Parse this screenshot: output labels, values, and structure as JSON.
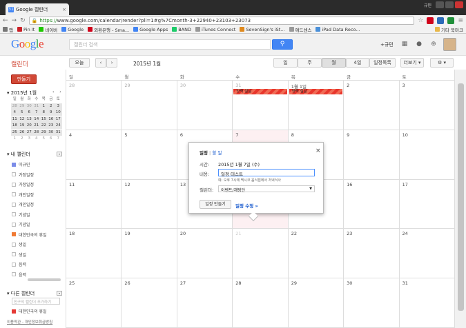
{
  "browser": {
    "tab_title": "Google 캘린더",
    "tab_close": "×",
    "user_badge": "규민",
    "url_https": "https://",
    "url_rest": "www.google.com/calendar/render?pli=1#g%7Cmonth-3+22940+23103+23073",
    "bookmarks": [
      {
        "label": "앱",
        "color": "#777777"
      },
      {
        "label": "Pin It",
        "color": "#cb2027"
      },
      {
        "label": "네이버",
        "color": "#1ec800"
      },
      {
        "label": "Google",
        "color": "#4285f4"
      },
      {
        "label": "외환은행 - Sma...",
        "color": "#d0021b"
      },
      {
        "label": "Google Apps",
        "color": "#4285f4"
      },
      {
        "label": "BAND",
        "color": "#1fcc6b"
      },
      {
        "label": "iTunes Connect",
        "color": "#999999"
      },
      {
        "label": "SevenSign's iSt...",
        "color": "#e08a1e"
      },
      {
        "label": "애드센스",
        "color": "#999999"
      },
      {
        "label": "iPad Data Reco...",
        "color": "#4a90d9"
      }
    ],
    "other_bookmarks": "기타 북마크"
  },
  "header": {
    "logo": "Google",
    "search_placeholder": "캘린더 검색",
    "search_icon": "🔍",
    "plus_user": "+규민",
    "icons": [
      "apps-icon",
      "notifications-icon",
      "share-icon"
    ],
    "icon_glyphs": [
      "▦",
      "●",
      "⊕"
    ]
  },
  "toolbar": {
    "title": "캘린더",
    "today": "오늘",
    "prev": "‹",
    "next": "›",
    "date_range": "2015년 1월",
    "views": [
      "일",
      "주",
      "월",
      "4일",
      "일정목록"
    ],
    "active_view": "월",
    "more": "더보기 ▾",
    "settings": "⚙ ▾"
  },
  "sidebar": {
    "create": "만들기",
    "mini_cal_title": "▾ 2015년 1월",
    "mini_nav": "‹ ›",
    "mini_dow": [
      "일",
      "월",
      "화",
      "수",
      "목",
      "금",
      "토"
    ],
    "mini_weeks": [
      [
        "28",
        "29",
        "30",
        "31",
        "1",
        "2",
        "3"
      ],
      [
        "4",
        "5",
        "6",
        "7",
        "8",
        "9",
        "10"
      ],
      [
        "11",
        "12",
        "13",
        "14",
        "15",
        "16",
        "17"
      ],
      [
        "18",
        "19",
        "20",
        "21",
        "22",
        "23",
        "24"
      ],
      [
        "25",
        "26",
        "27",
        "28",
        "29",
        "30",
        "31"
      ],
      [
        "1",
        "2",
        "3",
        "4",
        "5",
        "6",
        "7"
      ]
    ],
    "my_calendars_title": "▾ 내 캘린더",
    "my_calendars": [
      {
        "label": "이규민",
        "color": "#7b8ce8"
      },
      {
        "label": "가정일정",
        "color": ""
      },
      {
        "label": "가정일정",
        "color": ""
      },
      {
        "label": "개인일정",
        "color": ""
      },
      {
        "label": "개인일정",
        "color": ""
      },
      {
        "label": "기념일",
        "color": ""
      },
      {
        "label": "기념일",
        "color": ""
      },
      {
        "label": "대한민국의 휴일",
        "color": "#f07a34"
      },
      {
        "label": "생일",
        "color": ""
      },
      {
        "label": "생일",
        "color": ""
      },
      {
        "label": "음력",
        "color": ""
      },
      {
        "label": "음력",
        "color": ""
      }
    ],
    "other_calendars_title": "▾ 다른 캘린더",
    "add_friend_placeholder": "친구의 캘린더 추가하기",
    "other_calendars": [
      {
        "label": "대한민국의 휴일",
        "color": "#e53935"
      }
    ],
    "footer": "이용약관 - 개인정보취급방침"
  },
  "calendar": {
    "dow": [
      "일",
      "월",
      "화",
      "수",
      "목",
      "금",
      "토"
    ],
    "weeks": [
      [
        "28",
        "29",
        "30",
        "31",
        "1월 1일",
        "2",
        "3"
      ],
      [
        "4",
        "5",
        "6",
        "7",
        "8",
        "9",
        "10"
      ],
      [
        "11",
        "12",
        "13",
        "14",
        "15",
        "16",
        "17"
      ],
      [
        "18",
        "19",
        "20",
        "21",
        "22",
        "23",
        "24"
      ],
      [
        "25",
        "26",
        "27",
        "28",
        "29",
        "30",
        "31"
      ]
    ],
    "events": [
      {
        "label": "양력 설날",
        "week": 0,
        "day": 3
      },
      {
        "label": "양력 설날",
        "week": 0,
        "day": 4
      }
    ]
  },
  "popup": {
    "tab_event": "일정",
    "tab_sep": "|",
    "tab_task": "할 일",
    "close": "×",
    "time_label": "시간:",
    "time_value": "2015년 1월 7일 (수)",
    "content_label": "내용:",
    "content_value": "일정 테스트",
    "hint": "예: 오후 7시에 멕시코 음식점에서 저녁식사",
    "calendar_label": "캘린더:",
    "calendar_value": "이벤트/채팅단",
    "create_btn": "일정 만들기",
    "edit_link": "일정 수정 »"
  }
}
